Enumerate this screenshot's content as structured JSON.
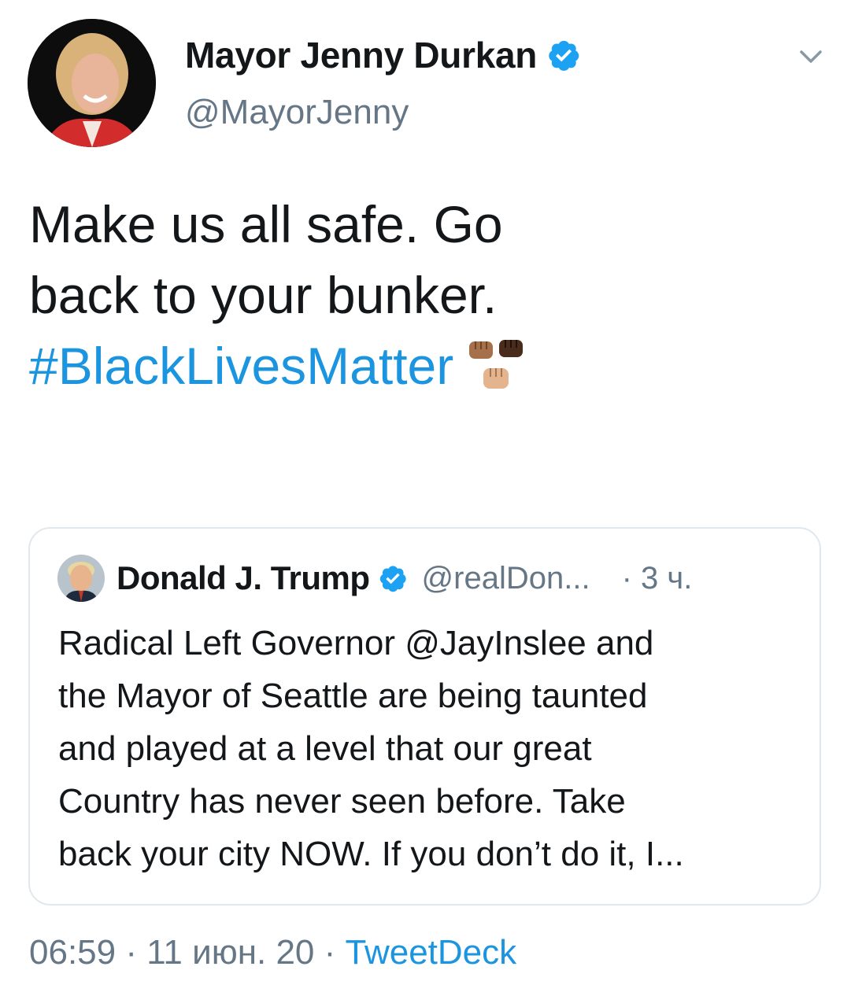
{
  "tweet": {
    "author": {
      "display_name": "Mayor Jenny Durkan",
      "handle": "@MayorJenny",
      "verified": true,
      "avatar_icon": "avatar-photo"
    },
    "text_lines": [
      "Make us all safe. Go",
      "back to your bunker."
    ],
    "hashtag": "#BlackLivesMatter",
    "emoji": "raised-fists-icon",
    "timestamp": "06:59",
    "date": "11 июн. 20",
    "separator": " · ",
    "source": "TweetDeck"
  },
  "quoted_tweet": {
    "author": {
      "display_name": "Donald J. Trump",
      "handle": "@realDon...",
      "verified": true
    },
    "time": "· 3 ч.",
    "text_lines": [
      "Radical Left Governor @JayInslee and",
      "the Mayor of Seattle are being taunted",
      "and played at a level that our great",
      "Country has never seen before. Take",
      "back your city NOW. If you don’t do it, I..."
    ]
  },
  "colors": {
    "link": "#1b95e0",
    "secondary_text": "#657786",
    "primary_text": "#14171a",
    "verified_badge": "#1da1f2",
    "card_border": "#e1e8ed"
  }
}
